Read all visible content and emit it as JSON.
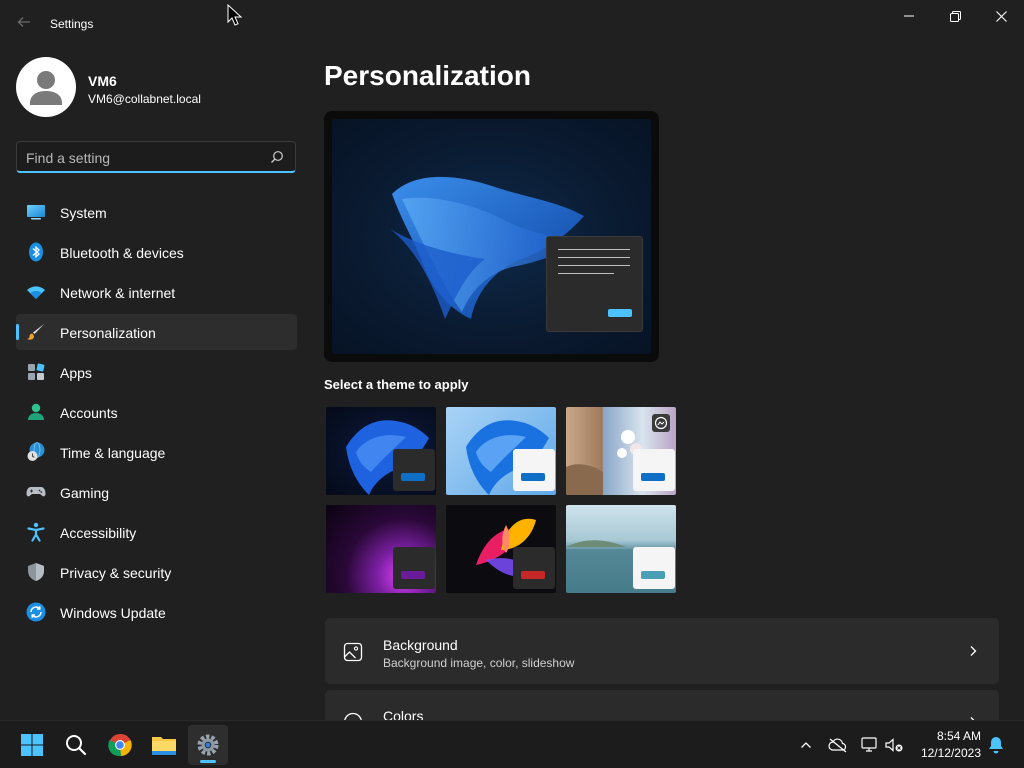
{
  "window": {
    "app_title": "Settings",
    "controls": [
      "minimize",
      "restore",
      "close"
    ]
  },
  "profile": {
    "name": "VM6",
    "email": "VM6@collabnet.local"
  },
  "search": {
    "placeholder": "Find a setting",
    "value": ""
  },
  "sidebar": {
    "items": [
      {
        "label": "System",
        "icon": "monitor-icon",
        "active": false
      },
      {
        "label": "Bluetooth & devices",
        "icon": "bluetooth-icon",
        "active": false
      },
      {
        "label": "Network & internet",
        "icon": "wifi-icon",
        "active": false
      },
      {
        "label": "Personalization",
        "icon": "paintbrush-icon",
        "active": true
      },
      {
        "label": "Apps",
        "icon": "apps-icon",
        "active": false
      },
      {
        "label": "Accounts",
        "icon": "person-icon",
        "active": false
      },
      {
        "label": "Time & language",
        "icon": "globe-clock-icon",
        "active": false
      },
      {
        "label": "Gaming",
        "icon": "gamepad-icon",
        "active": false
      },
      {
        "label": "Accessibility",
        "icon": "accessibility-icon",
        "active": false
      },
      {
        "label": "Privacy & security",
        "icon": "shield-icon",
        "active": false
      },
      {
        "label": "Windows Update",
        "icon": "update-icon",
        "active": false
      }
    ]
  },
  "main": {
    "page_title": "Personalization",
    "themes_label": "Select a theme to apply",
    "themes": [
      {
        "name": "windows-dark",
        "accent": "#0f6fc6"
      },
      {
        "name": "windows-light",
        "accent": "#0f6fc6"
      },
      {
        "name": "spotlight",
        "accent": "#0f6fc6",
        "slideshow": true
      },
      {
        "name": "glow",
        "accent": "#6a1b9a"
      },
      {
        "name": "captured-motion",
        "accent": "#c62828"
      },
      {
        "name": "flow",
        "accent": "#4a9fb5"
      }
    ],
    "cards": [
      {
        "title": "Background",
        "subtitle": "Background image, color, slideshow",
        "icon": "image-icon"
      },
      {
        "title": "Colors",
        "subtitle": "",
        "icon": "palette-icon"
      }
    ]
  },
  "taskbar": {
    "apps": [
      "start-icon",
      "search-icon",
      "chrome-icon",
      "file-explorer-icon",
      "settings-icon"
    ],
    "time": "8:54 AM",
    "date": "12/12/2023"
  },
  "colors": {
    "accent": "#4cc2ff",
    "background": "#202020",
    "card": "#2b2b2b"
  }
}
